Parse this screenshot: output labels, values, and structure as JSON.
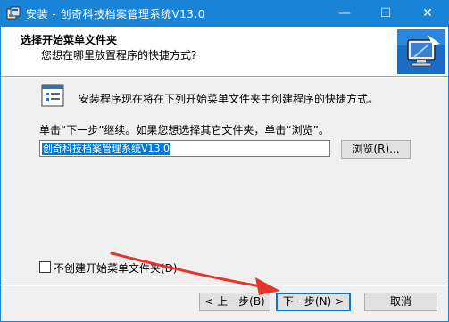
{
  "window": {
    "title": "安装 - 创奇科技档案管理系统V13.0",
    "minimize_glyph": "—",
    "maximize_glyph": "☐",
    "close_glyph": "✕"
  },
  "header": {
    "title": "选择开始菜单文件夹",
    "subtitle": "您想在哪里放置程序的快捷方式?"
  },
  "body": {
    "intro": "安装程序现在将在下列开始菜单文件夹中创建程序的快捷方式。",
    "instruction": "单击“下一步”继续。如果您想选择其它文件夹，单击“浏览”。",
    "folder_value": "创奇科技档案管理系统V13.0",
    "browse_label": "浏览(R)...",
    "no_folder_checkbox_label": "不创建开始菜单文件夹(D)",
    "no_folder_checked": false
  },
  "footer": {
    "back_label": "< 上一步(B)",
    "next_label": "下一步(N) >",
    "cancel_label": "取消"
  },
  "annotation": {
    "arrow_color": "#e8322c"
  },
  "colors": {
    "titlebar": "#1883d7",
    "selection": "#0078d7"
  },
  "icons": [
    "setup-app-icon",
    "monitor-installer-icon",
    "start-menu-folder-icon"
  ]
}
